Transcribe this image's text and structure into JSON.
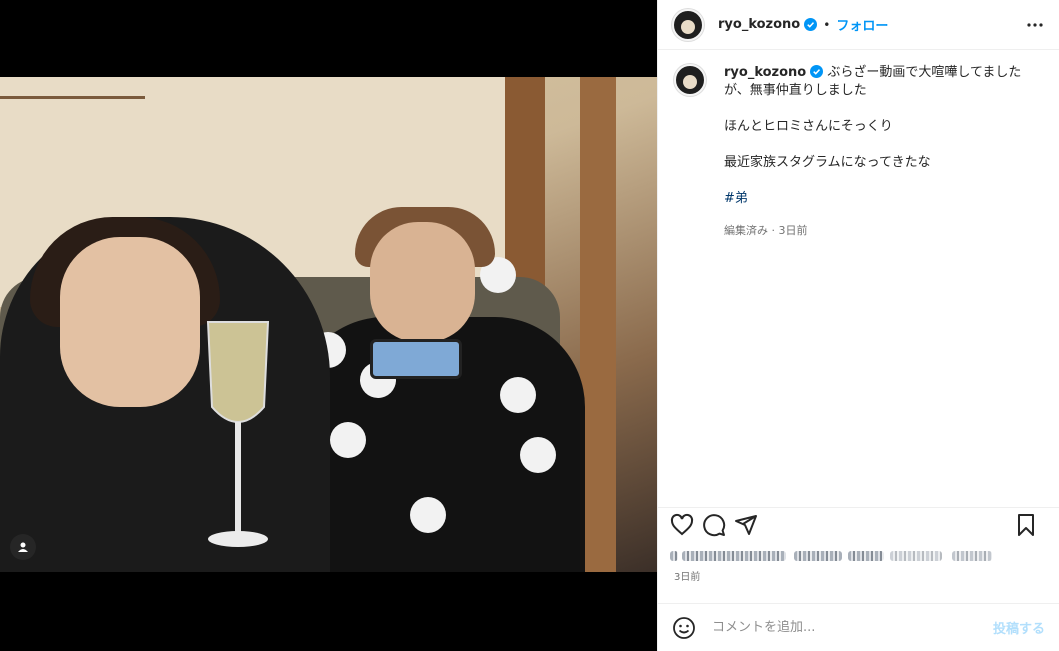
{
  "post": {
    "username": "ryo_kozono",
    "verified_icon": "verified-badge-icon",
    "separator": "•",
    "follow_label": "フォロー",
    "more_icon": "more-options-icon",
    "caption_lines": [
      "ぶらざー動画で大喧嘩してましたが、無事仲直りしました",
      "ほんとヒロミさんにそっくり",
      "最近家族スタグラムになってきたな"
    ],
    "hashtag": "#弟",
    "caption_meta": "編集済み · 3日前",
    "post_date": "3日前"
  },
  "actions": {
    "like_icon": "heart-icon",
    "comment_icon": "comment-icon",
    "share_icon": "share-icon",
    "save_icon": "bookmark-icon"
  },
  "comment": {
    "emoji_icon": "emoji-icon",
    "placeholder": "コメントを追加...",
    "post_label": "投稿する"
  },
  "colors": {
    "accent": "#0095f6",
    "hashtag": "#00376b",
    "muted": "#737373",
    "post_disabled": "#b2dffc"
  }
}
